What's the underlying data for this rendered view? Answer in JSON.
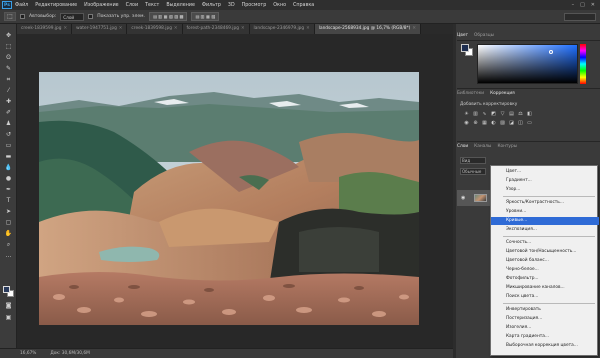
{
  "menubar": {
    "logo": "Ps",
    "items": [
      "Файл",
      "Редактирование",
      "Изображение",
      "Слои",
      "Текст",
      "Выделение",
      "Фильтр",
      "3D",
      "Просмотр",
      "Окно",
      "Справка"
    ],
    "controls": [
      "–",
      "□",
      "✕"
    ]
  },
  "options": {
    "tool_icon": "⬚",
    "mode_label": "Автовыбор:",
    "mode_value": "Слой",
    "show_controls_label": "Показать упр. элем."
  },
  "tabs": [
    "creek-1839599.jpg",
    "water-1947751.jpg",
    "creek-1839598.jpg",
    "forest-path-2348469.jpg",
    "landscape-2346979.jpg",
    "landscape-2568934.jpg @ 16,7% (RGB/8*)"
  ],
  "status": {
    "zoom": "16,67%",
    "doc": "Док: 30,6M/30,6M"
  },
  "panels": {
    "color_tabs": [
      "Цвет",
      "Образцы"
    ],
    "adjust_tabs": [
      "Библиотеки",
      "Коррекция"
    ],
    "adjust_label": "Добавить корректировку",
    "layers_tabs": [
      "Слои",
      "Каналы",
      "Контуры"
    ],
    "kind_select": "Вид",
    "blend_select": "Обычные"
  },
  "dropdown": {
    "items": [
      "Цвет...",
      "Градиент...",
      "Узор...",
      "Яркость/Контрастность...",
      "Уровни...",
      "Кривые...",
      "Экспозиция...",
      "Сочность...",
      "Цветовой тон/Насыщенность...",
      "Цветовой баланс...",
      "Черно-белое...",
      "Фотофильтр...",
      "Микширование каналов...",
      "Поиск цвета...",
      "Инвертировать",
      "Постеризация...",
      "Изогелия...",
      "Карта градиента...",
      "Выборочная коррекция цвета..."
    ],
    "highlighted": "Кривые..."
  },
  "colors": {
    "accent": "#2f6bd6",
    "foreground": "#1e2e50",
    "background": "#ffffff"
  }
}
